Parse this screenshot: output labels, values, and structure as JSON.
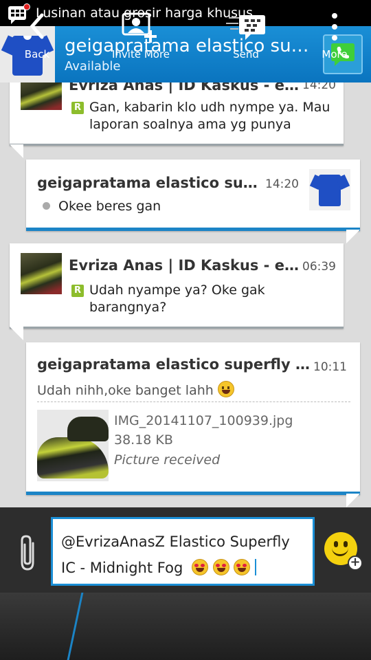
{
  "status_bar": {
    "notification_text": "Lusinan atau grosir harga khusus,"
  },
  "header": {
    "contact_name": "geigapratama elastico sup…",
    "status": "Available"
  },
  "messages": [
    {
      "sender": "Evriza Anas | ID Kaskus - ev…",
      "time": "14:20",
      "text_line1": "Gan, kabarin klo udh nympe ya. Mau",
      "text_line2": "laporan soalnya ama yg punya",
      "badge": "R"
    },
    {
      "sender": "geigapratama elastico sup…",
      "time": "14:20",
      "text_line1": "Okee beres gan"
    },
    {
      "sender": "Evriza Anas | ID Kaskus - ev…",
      "time": "06:39",
      "text_line1": "Udah nyampe ya? Oke gak",
      "text_line2": "barangnya?",
      "badge": "R"
    },
    {
      "sender": "geigapratama elastico superfly ic (4…",
      "time": "10:11",
      "text_line1": "Udah nihh,oke banget lahh",
      "file_name": "IMG_20141107_100939.jpg",
      "file_size": "38.18 KB",
      "file_status": "Picture received"
    }
  ],
  "compose": {
    "line1": "@EvrizaAnasZ Elastico Superfly",
    "line2": "IC - Midnight Fog"
  },
  "bottom_bar": {
    "back": "Back",
    "invite_more": "Invite More",
    "send": "Send",
    "more": "More"
  },
  "colors": {
    "accent": "#1b84c6",
    "header": "#0a74bf",
    "read_badge": "#8dbd2c"
  }
}
